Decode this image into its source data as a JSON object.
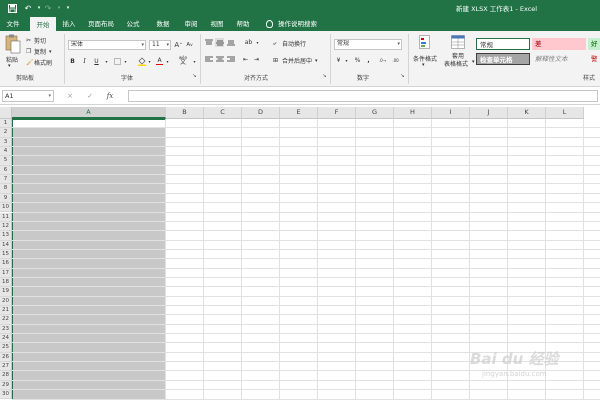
{
  "window": {
    "title": "新建 XLSX 工作表1  -  Excel",
    "accent": "#217346"
  },
  "quick_access": {
    "save_icon": "save-icon",
    "undo_icon": "undo-icon",
    "redo_icon": "redo-icon",
    "customize_icon": "customize-icon"
  },
  "tabs": [
    {
      "label": "文件"
    },
    {
      "label": "开始",
      "active": true
    },
    {
      "label": "插入"
    },
    {
      "label": "页面布局"
    },
    {
      "label": "公式"
    },
    {
      "label": "数据"
    },
    {
      "label": "审阅"
    },
    {
      "label": "视图"
    },
    {
      "label": "帮助"
    }
  ],
  "tell_me": "操作说明搜索",
  "ribbon": {
    "clipboard": {
      "paste": "粘贴",
      "cut": "剪切",
      "copy": "复制",
      "format_painter": "格式刷",
      "group": "剪贴板"
    },
    "font": {
      "font_name": "宋体",
      "font_size": "11",
      "bold": "B",
      "italic": "I",
      "underline": "U",
      "grow": "A",
      "shrink": "A",
      "font_color_letter": "A",
      "wen": "wén",
      "group": "字体"
    },
    "alignment": {
      "wrap_text": "自动换行",
      "merge_center": "合并后居中",
      "group": "对齐方式"
    },
    "number": {
      "format": "常规",
      "percent": "%",
      "comma": ",",
      "group": "数字"
    },
    "styles": {
      "conditional_formatting": "条件格式",
      "format_as_table_line1": "套用",
      "format_as_table_line2": "表格格式",
      "normal": "常规",
      "bad": "差",
      "good": "好",
      "check_cell": "检查单元格",
      "explanatory": "解释性文本",
      "warning": "警",
      "group": "样式"
    }
  },
  "formula_bar": {
    "name_box": "A1",
    "cancel": "×",
    "enter": "✓",
    "fx": "fx",
    "value": ""
  },
  "grid": {
    "columns": [
      "A",
      "B",
      "C",
      "D",
      "E",
      "F",
      "G",
      "H",
      "I",
      "J",
      "K",
      "L"
    ],
    "rows": [
      "1",
      "2",
      "3",
      "4",
      "5",
      "6",
      "7",
      "8",
      "9",
      "10",
      "11",
      "12",
      "13",
      "14",
      "15",
      "16",
      "17",
      "18",
      "19",
      "20",
      "21",
      "22",
      "23",
      "24",
      "25",
      "26",
      "27",
      "28",
      "29",
      "30"
    ],
    "selected_column": "A",
    "active_cell": "A1"
  },
  "watermark": {
    "text": "Bai du 经验",
    "sub": "jingyan.baidu.com"
  }
}
